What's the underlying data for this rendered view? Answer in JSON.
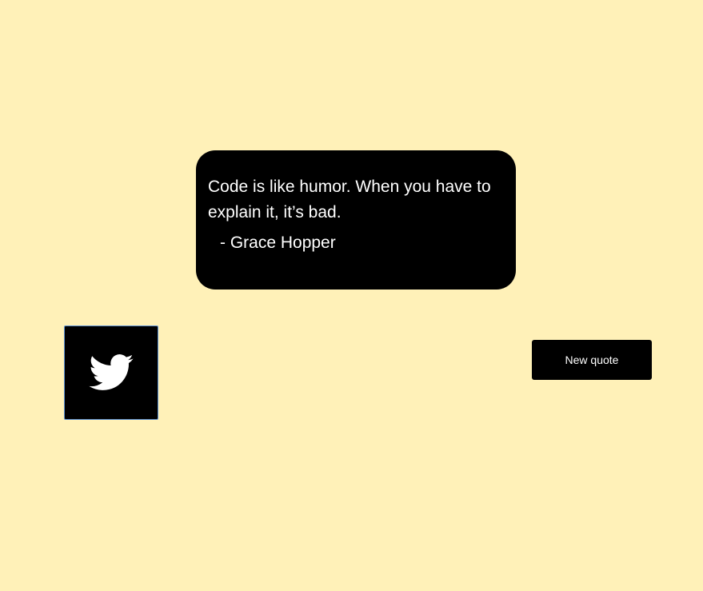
{
  "quote": {
    "text": "Code is like humor. When you have to explain it, it’s bad.",
    "author": "- Grace Hopper"
  },
  "actions": {
    "tweet_icon": "twitter-bird-icon",
    "new_quote_label": "New quote"
  },
  "colors": {
    "background": "#fff1b8",
    "box": "#000000",
    "text": "#ffffff"
  }
}
